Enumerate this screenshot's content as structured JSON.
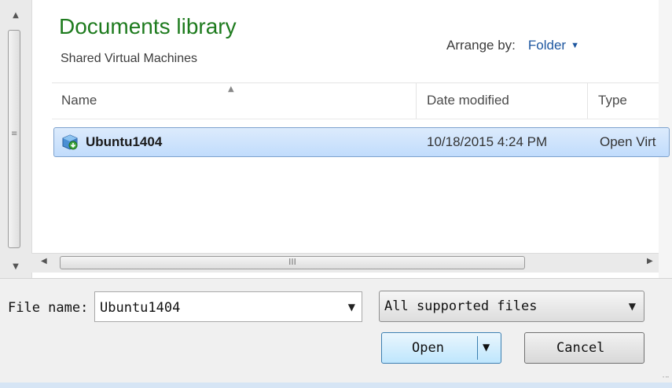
{
  "library": {
    "title": "Documents library",
    "subtitle": "Shared Virtual Machines",
    "arrange_label": "Arrange by:",
    "arrange_value": "Folder"
  },
  "columns": {
    "name": "Name",
    "date": "Date modified",
    "type": "Type"
  },
  "files": [
    {
      "name": "Ubuntu1404",
      "date": "10/18/2015 4:24 PM",
      "type": "Open Virt",
      "icon": "virtual-machine-icon",
      "selected": true
    }
  ],
  "scroll": {
    "hscroll_grip": "III"
  },
  "footer": {
    "filename_label": "File name:",
    "filename_value": "Ubuntu1404",
    "filter_value": "All supported files",
    "open_label": "Open",
    "cancel_label": "Cancel"
  },
  "colors": {
    "title_green": "#1e7b1e",
    "link_blue": "#1e57a0",
    "selection_border": "#7da2ce",
    "selection_fill": "#c1dcfc"
  }
}
